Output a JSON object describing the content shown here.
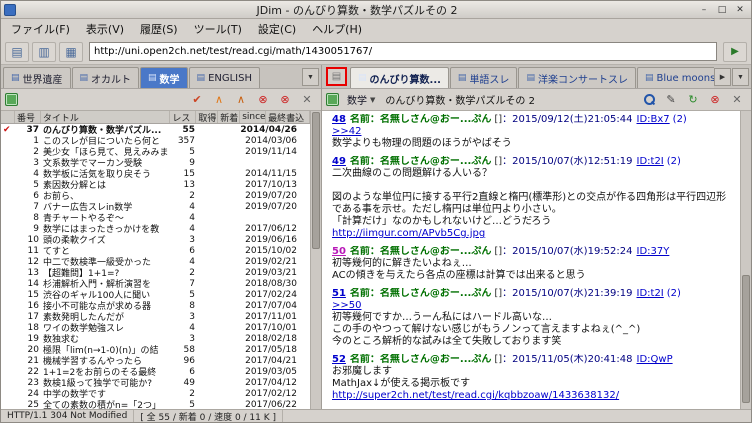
{
  "colors": {
    "selected_tab_blue": "#4a78c8",
    "link_blue": "#0000cc",
    "name_green": "#007000",
    "date_navy": "#000080",
    "visited_magenta": "#b818b8",
    "marker_red": "#d01010",
    "bookmark_red": "#cc1111"
  },
  "icons": {
    "minimize_icon": "–",
    "maximize_icon": "□",
    "close_icon": "✕",
    "chevron_down_icon": "▼",
    "chevron_right_icon": "▶",
    "go_icon": "▶",
    "thread_list_icon": "▤",
    "board_tab_icon": "▤",
    "thread_tab_icon": "▤",
    "bookmark_check_icon": "✔",
    "new_post_marker_icon": "▶"
  },
  "titlebar": {
    "title": "JDim - のんびり算数・数学パズルその 2"
  },
  "menubar": {
    "items": [
      "ファイル(F)",
      "表示(V)",
      "履歴(S)",
      "ツール(T)",
      "設定(C)",
      "ヘルプ(H)"
    ]
  },
  "toolbar": {
    "left_buttons": [
      {
        "id": "view-board",
        "glyph": "▤",
        "color": "#4a6a9a"
      },
      {
        "id": "view-thread",
        "glyph": "▥",
        "color": "#4a6a9a"
      },
      {
        "id": "view-image",
        "glyph": "▦",
        "color": "#4a6a9a"
      }
    ],
    "url": "http://uni.open2ch.net/test/read.cgi/math/1430051767/"
  },
  "board_tabbar": {
    "tabs": [
      {
        "label": "世界遺産",
        "selected": false
      },
      {
        "label": "オカルト",
        "selected": false
      },
      {
        "label": "数学",
        "selected": true
      },
      {
        "label": "ENGLISH",
        "selected": false
      }
    ]
  },
  "board_pane": {
    "toolbar_buttons": [
      {
        "id": "check-update",
        "glyph": "✔",
        "color": "#cc4422"
      },
      {
        "id": "move-up",
        "glyph": "∧",
        "color": "#e07818"
      },
      {
        "id": "update",
        "glyph": "∧",
        "color": "#c86010"
      },
      {
        "id": "cancel",
        "glyph": "⊗",
        "color": "#cc2222"
      },
      {
        "id": "stop",
        "glyph": "⊗",
        "color": "#cc2222"
      },
      {
        "id": "close",
        "glyph": "✕",
        "color": "#666666"
      }
    ],
    "columns": [
      "",
      "番号",
      "タイトル",
      "レス",
      "取得",
      "新着",
      "since",
      "最終書込"
    ],
    "rows": [
      {
        "bookmark": true,
        "bold": true,
        "num": "37",
        "title": "のんびり算数・数学パズル...",
        "res": "55",
        "date": "2014/04/26"
      },
      {
        "num": "1",
        "title": "このスレが目についたら何と",
        "res": "357",
        "date": "2014/03/06"
      },
      {
        "num": "2",
        "title": "美少女「ほら見て、見えみみま",
        "res": "5",
        "date": "2019/11/14"
      },
      {
        "num": "3",
        "title": "文系数学でマーカン受験",
        "res": "9",
        "date": ""
      },
      {
        "num": "4",
        "title": "数学板に活気を取り戻そう",
        "res": "15",
        "date": "2014/11/15"
      },
      {
        "num": "5",
        "title": "素因数分解とは",
        "res": "13",
        "date": "2017/10/13"
      },
      {
        "num": "6",
        "title": "お前ら、",
        "res": "2",
        "date": "2019/07/20"
      },
      {
        "num": "7",
        "title": "バナー広告スレin数学",
        "res": "4",
        "date": "2019/07/20"
      },
      {
        "num": "8",
        "title": "青チャートやるぞ〜",
        "res": "4",
        "date": ""
      },
      {
        "num": "9",
        "title": "数学にはまったきっかけを教",
        "res": "4",
        "date": "2017/06/12"
      },
      {
        "num": "10",
        "title": "頭の柔軟クイズ",
        "res": "3",
        "date": "2019/06/16"
      },
      {
        "num": "11",
        "title": "てすと",
        "res": "6",
        "date": "2015/10/02"
      },
      {
        "num": "12",
        "title": "中二で数検準一級受かった",
        "res": "4",
        "date": "2019/02/21"
      },
      {
        "num": "13",
        "title": "【超難問】1+1=?",
        "res": "2",
        "date": "2019/03/21"
      },
      {
        "num": "14",
        "title": "杉浦解析入門・解析演習を",
        "res": "7",
        "date": "2018/08/30"
      },
      {
        "num": "15",
        "title": "渋谷のギャル100人に聞い",
        "res": "5",
        "date": "2017/02/24"
      },
      {
        "num": "16",
        "title": "接小不可能な点が求める器",
        "res": "8",
        "date": "2017/07/04"
      },
      {
        "num": "17",
        "title": "素数発明したんだが",
        "res": "3",
        "date": "2017/11/01"
      },
      {
        "num": "18",
        "title": "ワイの数学勉強スレ",
        "res": "4",
        "date": "2017/10/01"
      },
      {
        "num": "19",
        "title": "数独求む",
        "res": "3",
        "date": "2018/02/18"
      },
      {
        "num": "20",
        "title": "極限「lim(n→1-0)(n)」の結",
        "res": "58",
        "date": "2017/05/18"
      },
      {
        "num": "21",
        "title": "機械学習するんやったら",
        "res": "96",
        "date": "2017/04/21"
      },
      {
        "num": "22",
        "title": "1+1=2をお前らのそる最終",
        "res": "6",
        "date": "2019/03/05"
      },
      {
        "num": "23",
        "title": "数検1級って独学で可能か?",
        "res": "49",
        "date": "2017/04/12"
      },
      {
        "num": "24",
        "title": "中学の数学です",
        "res": "2",
        "date": "2017/02/12"
      },
      {
        "num": "25",
        "title": "全ての素数の積がn=「2つ」",
        "res": "5",
        "date": "2017/06/22"
      }
    ]
  },
  "thread_tabbar": {
    "tabs": [
      {
        "label": "のんびり算数...",
        "selected": true
      },
      {
        "label": "単語スレ",
        "selected": false
      },
      {
        "label": "洋楽コンサートスレ",
        "selected": false
      },
      {
        "label": "Blue moonston...",
        "selected": false
      }
    ]
  },
  "thread_pane": {
    "board_select": "数学",
    "title": "のんびり算数・数学パズルその 2",
    "toolbar_buttons": [
      {
        "id": "search",
        "css": "magnifier"
      },
      {
        "id": "compose",
        "glyph": "✎",
        "color": "#444444"
      },
      {
        "id": "reload",
        "glyph": "↻",
        "color": "#2a8a2a"
      },
      {
        "id": "stop",
        "glyph": "⊗",
        "color": "#cc2222"
      },
      {
        "id": "close",
        "glyph": "✕",
        "color": "#666666"
      }
    ],
    "posts": [
      {
        "num": "48",
        "name": "名前：名無しさん@おー...ぷん",
        "bracket": "[]",
        "datetime": "：2015/09/12(土)21:05:44",
        "id": "ID:Bx7",
        "id_count": "(2)",
        "body": [
          {
            "t": "link",
            "s": ">>42"
          },
          {
            "t": "text",
            "s": "数学よりも物理の問題のほうがやばそう"
          }
        ]
      },
      {
        "num": "49",
        "marker": true,
        "name": "名前：名無しさん@おー...ぷん",
        "bracket": "[]",
        "datetime": "：2015/10/07(水)12:51:19",
        "id": "ID:t2I",
        "id_count": "(2)",
        "body": [
          {
            "t": "text",
            "s": "二次曲線のこの問題解ける人いる？"
          },
          {
            "t": "blank",
            "s": ""
          },
          {
            "t": "text",
            "s": "図のような単位円に接する平行2直線と楕円(標準形)との交点が作る四角形は平行四辺形である事を示せ。ただし楕円は単位円より小さい。"
          },
          {
            "t": "text",
            "s": "「計算だけ」なのかもしれないけど…どうだろう"
          },
          {
            "t": "link",
            "s": "http://iimgur.com/APvb5Cg.jpg"
          }
        ]
      },
      {
        "num": "50",
        "visited": true,
        "name": "名前：名無しさん@おー...ぷん",
        "bracket": "[]",
        "datetime": "：2015/10/07(水)19:52:24",
        "id": "ID:37Y",
        "id_count": "",
        "body": [
          {
            "t": "text",
            "s": "初等幾何的に解きたいよねぇ…"
          },
          {
            "t": "text",
            "s": "ACの傾きを与えたら各点の座標は計算では出来ると思う"
          }
        ]
      },
      {
        "num": "51",
        "name": "名前：名無しさん@おー...ぷん",
        "bracket": "[]",
        "datetime": "：2015/10/07(水)21:39:19",
        "id": "ID:t2I",
        "id_count": "(2)",
        "body": [
          {
            "t": "link",
            "s": ">>50"
          },
          {
            "t": "text",
            "s": "初等幾何ですか…うーん私にはハードル高いな…"
          },
          {
            "t": "text",
            "s": "この手のやつって解けない感じがもうノンって言えますよねぇ(^_^)"
          },
          {
            "t": "text",
            "s": "今のところ解析的な試みは全て失敗しております笑"
          }
        ]
      },
      {
        "num": "52",
        "name": "名前：名無しさん@おー...ぷん",
        "bracket": "[]",
        "datetime": "：2015/11/05(木)20:41:48",
        "id": "ID:QwP",
        "id_count": "",
        "body": [
          {
            "t": "text",
            "s": "お邪魔します"
          },
          {
            "t": "text",
            "s": "MathJax↓が使える掲示板です"
          },
          {
            "t": "link",
            "s": "http://super2ch.net/test/read.cgi/kqbbzoaw/1433638132/"
          }
        ]
      }
    ]
  },
  "statusbar": {
    "http": "HTTP/1.1 304 Not Modified",
    "counts": "[ 全 55 / 新着 0 / 速度 0 / 11 K ]"
  }
}
